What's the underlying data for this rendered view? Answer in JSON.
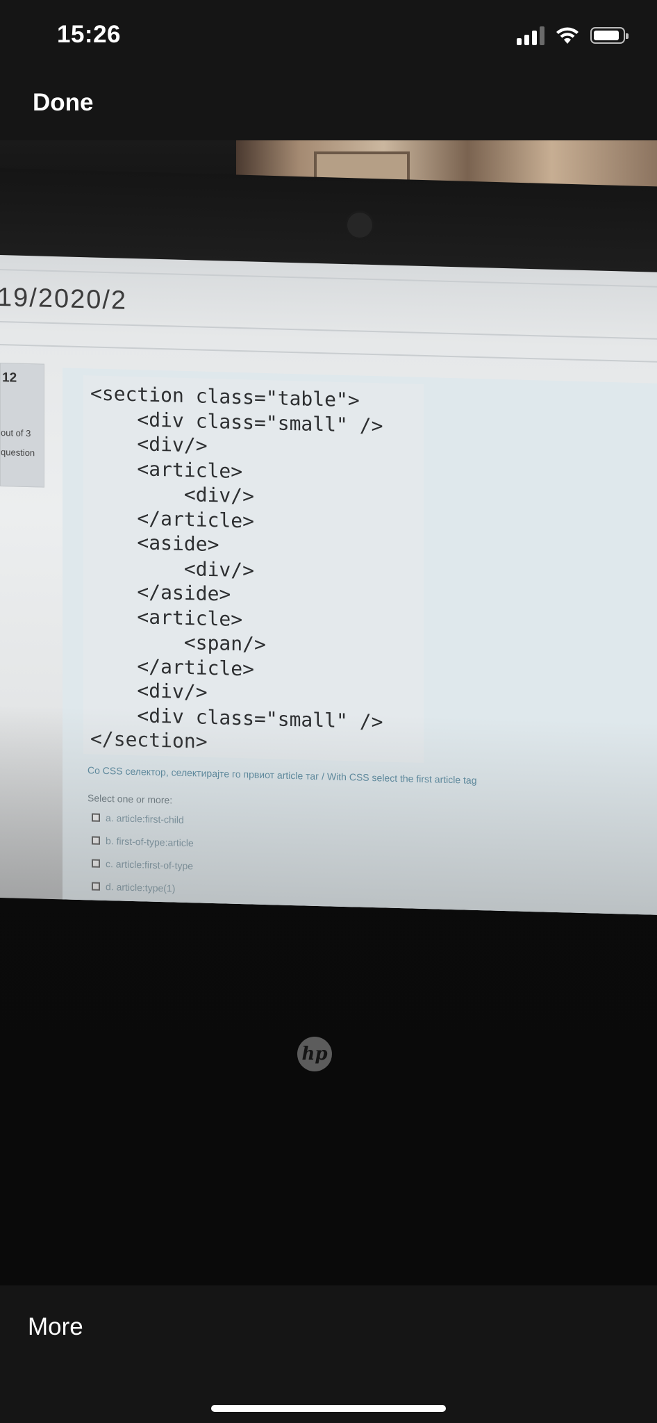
{
  "status_bar": {
    "time": "15:26",
    "icons": [
      "cellular-signal-icon",
      "wifi-icon",
      "battery-icon"
    ]
  },
  "nav": {
    "done_label": "Done"
  },
  "photo": {
    "page_heading": "19/2020/2",
    "question_info": {
      "number": "12",
      "marks": "out of 3",
      "flag": "question"
    },
    "code_lines": [
      "<section class=\"table\">",
      "    <div class=\"small\" />",
      "    <div/>",
      "    <article>",
      "        <div/>",
      "    </article>",
      "    <aside>",
      "        <div/>",
      "    </aside>",
      "    <article>",
      "        <span/>",
      "    </article>",
      "    <div/>",
      "    <div class=\"small\" />",
      "</section>"
    ],
    "question_text": "Со CSS селектор, селектирајте го првиот article таг / With CSS select the first article tag",
    "select_label": "Select one or more:",
    "options": [
      "a. article:first-child",
      "b. first-of-type:article",
      "c. article:first-of-type",
      "d. article:type(1)"
    ],
    "laptop_logo": "hp"
  },
  "bottom_bar": {
    "more_label": "More"
  }
}
